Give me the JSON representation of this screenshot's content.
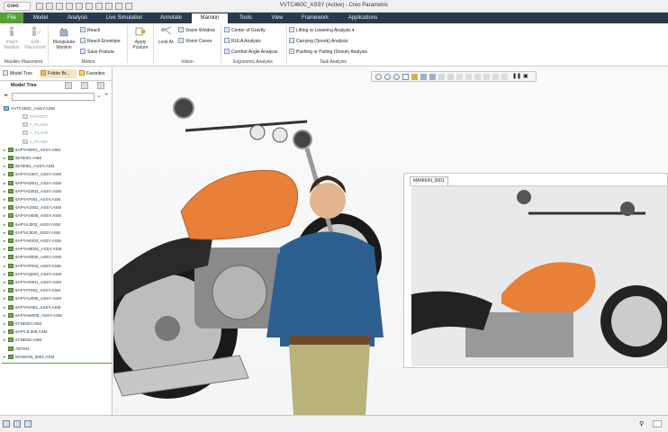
{
  "titlebar": {
    "logo": "creo",
    "window_title": "VVTC460C_ASSY (Active) - Creo Parametric"
  },
  "tabs": [
    {
      "label": "File"
    },
    {
      "label": "Model"
    },
    {
      "label": "Analysis"
    },
    {
      "label": "Live Simulation"
    },
    {
      "label": "Annotate"
    },
    {
      "label": "Manikin"
    },
    {
      "label": "Tools"
    },
    {
      "label": "View"
    },
    {
      "label": "Framework"
    },
    {
      "label": "Applications"
    }
  ],
  "ribbon": {
    "insert_manikin": "Insert Manikin",
    "edit_placement": "Edit Placement",
    "group_manikin_placement": "Manikin Placement",
    "manipulate_manikin": "Manipulate Manikin",
    "reach": "Reach",
    "reach_envelope": "Reach Envelope",
    "save_posture": "Save Posture",
    "group_motion": "Motion",
    "apply_posture": "Apply Posture",
    "look_at": "Look At",
    "vision_window": "Vision Window",
    "vision_cones": "Vision Cones",
    "group_vision": "Vision",
    "center_of_gravity": "Center of Gravity",
    "rula_analysis": "RULA Analysis",
    "comfort_angle_analysis": "Comfort Angle Analysis",
    "group_ergonomic": "Ergonomic Analysis",
    "lifting_lowering": "Lifting or Lowering Analysis",
    "carrying": "Carrying (Snook) Analysis",
    "pushing_pulling": "Pushing or Pulling (Snook) Analysis",
    "group_task": "Task Analysis"
  },
  "left_panel": {
    "tabs": [
      "Model Tree",
      "Folder Br...",
      "Favorites"
    ],
    "header": "Model Tree",
    "root": "VVTC460C_ASSY.ASM",
    "items": [
      {
        "label": "DRIVEOT",
        "dim": true,
        "toggle": ""
      },
      {
        "label": "F_PLANE",
        "dim": true,
        "toggle": ""
      },
      {
        "label": "Y_PLANE",
        "dim": true,
        "toggle": ""
      },
      {
        "label": "Z_PLANE",
        "dim": true,
        "toggle": ""
      },
      {
        "label": "6APYA8003_ASSY.ASM",
        "dim": false,
        "toggle": "▸"
      },
      {
        "label": "6575001.ASM",
        "dim": false,
        "toggle": "▸"
      },
      {
        "label": "6575001_ASSY.ASM",
        "dim": false,
        "toggle": "▸"
      },
      {
        "label": "6APYAC007_ASSY.ASM",
        "dim": false,
        "toggle": "▸"
      },
      {
        "label": "6APYAD001_ASSY.ASM",
        "dim": false,
        "toggle": "▸"
      },
      {
        "label": "6APYAD003_ASSY.ASM",
        "dim": false,
        "toggle": "▸"
      },
      {
        "label": "6APYAF001_ASSY.ASM",
        "dim": false,
        "toggle": "▸"
      },
      {
        "label": "6APYAG002_ASSY.ASM",
        "dim": false,
        "toggle": "▸"
      },
      {
        "label": "6APYAH006_ASSY.ASM",
        "dim": false,
        "toggle": "▸"
      },
      {
        "label": "6APYAJ003_ASSY.ASM",
        "dim": false,
        "toggle": "▸"
      },
      {
        "label": "6APYAJ020_ASSY.ASM",
        "dim": false,
        "toggle": "▸"
      },
      {
        "label": "6APYAK003_ASSY.ASM",
        "dim": false,
        "toggle": "▸"
      },
      {
        "label": "6APYAM002_ASSY.ASM",
        "dim": false,
        "toggle": "▸"
      },
      {
        "label": "6APYAN005_ASSY.ASM",
        "dim": false,
        "toggle": "▸"
      },
      {
        "label": "6APYAP003_ASSY.ASM",
        "dim": false,
        "toggle": "▸"
      },
      {
        "label": "6APYAQ003_ASSY.ASM",
        "dim": false,
        "toggle": "▸"
      },
      {
        "label": "6APYAR001_ASSY.ASM",
        "dim": false,
        "toggle": "▸"
      },
      {
        "label": "6APYAT003_ASSY.ASM",
        "dim": false,
        "toggle": "▸"
      },
      {
        "label": "6APYAU005_ASSY.ASM",
        "dim": false,
        "toggle": "▸"
      },
      {
        "label": "6APYAV004_ASSY.ASM",
        "dim": false,
        "toggle": "▸"
      },
      {
        "label": "6APYAW005_ASSY.ASM",
        "dim": false,
        "toggle": "▸"
      },
      {
        "label": "6748020.ASM",
        "dim": false,
        "toggle": "▸"
      },
      {
        "label": "6APYJL008.ASM",
        "dim": false,
        "toggle": "▸"
      },
      {
        "label": "6748016.ASM",
        "dim": false,
        "toggle": "▸"
      },
      {
        "label": "ADTM1",
        "dim": false,
        "toggle": ""
      },
      {
        "label": "MANIKIN_0001.ASM",
        "dim": false,
        "toggle": "▸"
      }
    ]
  },
  "vision_window": {
    "title": "MANIKIN_0001"
  }
}
